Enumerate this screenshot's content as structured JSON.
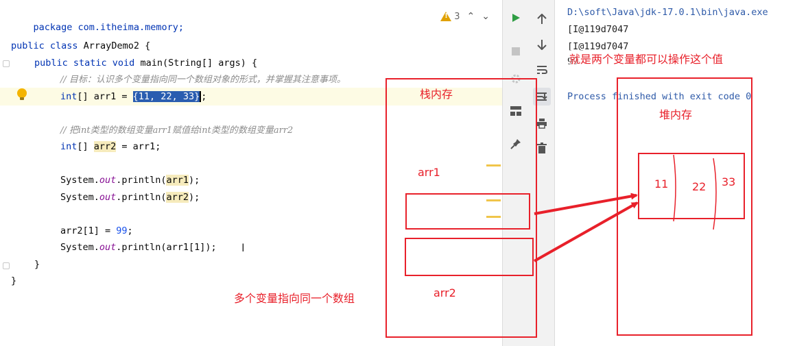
{
  "editor": {
    "warnings_count": "3",
    "lines": {
      "l1": "package com.itheima.memory;",
      "l3_kw": "public class",
      "l3_rest": " ArrayDemo2 {",
      "l4_kw": "public static void",
      "l4_rest": " main(String[] args) {",
      "l5_comment": "// 目标：认识多个变量指向同一个数组对象的形式，并掌握其注意事项。",
      "l6_kw": "int",
      "l6_mid": "[] arr1 = ",
      "l6_sel": "{11, 22, 33}",
      "l6_end": ";",
      "l8_comment": "// 把int类型的数组变量arr1赋值给int类型的数组变量arr2",
      "l9_kw": "int",
      "l9_mid": "[] ",
      "l9_hl": "arr2",
      "l9_end": " = arr1;",
      "l11_a": "System.",
      "l11_fld": "out",
      "l11_b": ".println(",
      "l11_hl": "arr1",
      "l11_c": ");",
      "l12_a": "System.",
      "l12_fld": "out",
      "l12_b": ".println(",
      "l12_hl": "arr2",
      "l12_c": ");",
      "l14_a": "arr2[1] = ",
      "l14_num": "99",
      "l14_c": ";",
      "l15_a": "System.",
      "l15_fld": "out",
      "l15_b": ".println(arr1[1]);",
      "l16": "}",
      "l17": "}"
    }
  },
  "console": {
    "line1": "D:\\soft\\Java\\jdk-17.0.1\\bin\\java.exe",
    "line2": "[I@119d7047",
    "line3": "[I@119d7047",
    "line4": "99",
    "line5": "Process finished with exit code 0"
  },
  "annotations": {
    "stack_label": "栈内存",
    "heap_label": "堆内存",
    "arr1_label": "arr1",
    "arr2_label": "arr2",
    "both_vars": "就是两个变量都可以操作这个值",
    "multi_vars": "多个变量指向同一个数组",
    "cell1": "11",
    "cell2": "22",
    "cell3": "33"
  },
  "colors": {
    "annotation_red": "#e8202a",
    "keyword_blue": "#0033b3",
    "selection_blue": "#2a5db0"
  },
  "icons": {
    "run": "run-icon",
    "stop": "stop-icon",
    "settings": "settings-icon",
    "layout": "layout-icon",
    "pin": "pin-icon",
    "up": "arrow-up-icon",
    "down": "arrow-down-icon",
    "wrap": "soft-wrap-icon",
    "scroll_end": "scroll-to-end-icon",
    "print": "print-icon",
    "trash": "trash-icon"
  }
}
